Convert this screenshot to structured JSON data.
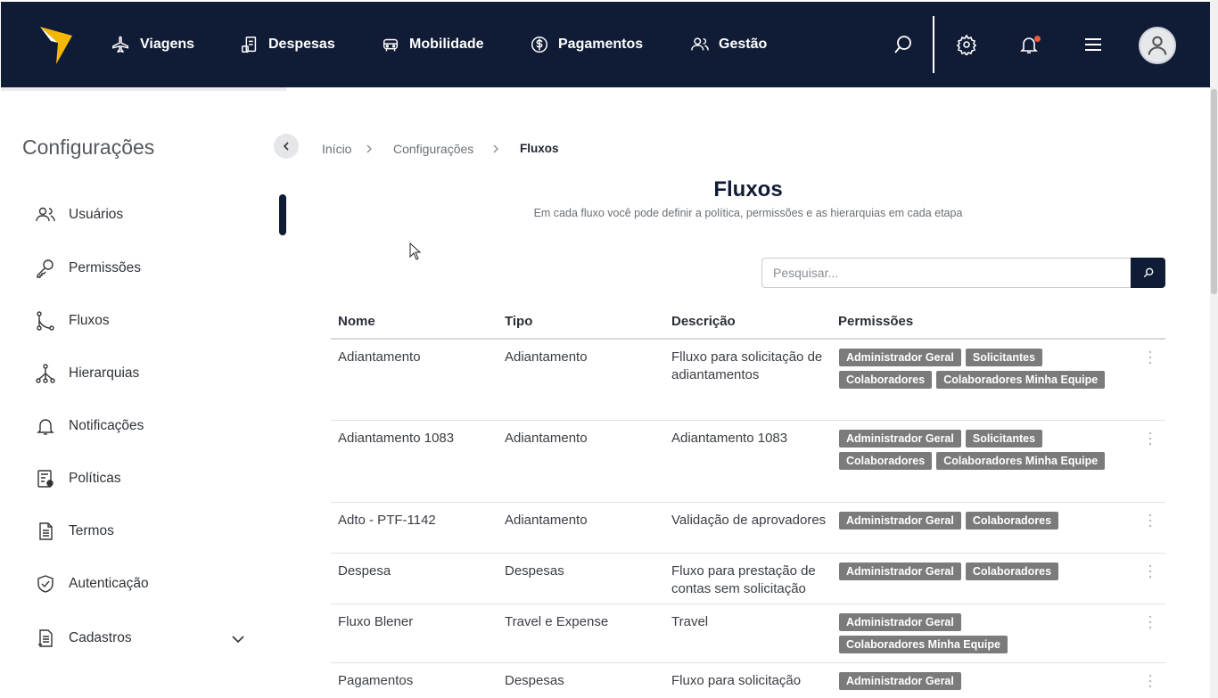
{
  "nav": {
    "items": [
      {
        "label": "Viagens",
        "icon": "airplane-icon"
      },
      {
        "label": "Despesas",
        "icon": "receipt-icon"
      },
      {
        "label": "Mobilidade",
        "icon": "car-icon"
      },
      {
        "label": "Pagamentos",
        "icon": "dollar-circle-icon"
      },
      {
        "label": "Gestão",
        "icon": "users-icon"
      }
    ]
  },
  "sidebar": {
    "title": "Configurações",
    "items": [
      {
        "label": "Usuários",
        "icon": "users-icon"
      },
      {
        "label": "Permissões",
        "icon": "key-icon"
      },
      {
        "label": "Fluxos",
        "icon": "flow-icon"
      },
      {
        "label": "Hierarquias",
        "icon": "hierarchy-icon"
      },
      {
        "label": "Notificações",
        "icon": "bell-icon"
      },
      {
        "label": "Políticas",
        "icon": "policy-icon"
      },
      {
        "label": "Termos",
        "icon": "document-icon"
      },
      {
        "label": "Autenticação",
        "icon": "shield-icon"
      },
      {
        "label": "Cadastros",
        "icon": "file-list-icon"
      }
    ]
  },
  "breadcrumb": {
    "items": [
      "Início",
      "Configurações",
      "Fluxos"
    ]
  },
  "page": {
    "title": "Fluxos",
    "subtitle": "Em cada fluxo você pode definir a política, permissões e as hierarquias em cada etapa"
  },
  "search": {
    "placeholder": "Pesquisar..."
  },
  "table": {
    "headers": [
      "Nome",
      "Tipo",
      "Descrição",
      "Permissões"
    ],
    "rows": [
      {
        "name": "Adiantamento",
        "type": "Adiantamento",
        "desc": "Flluxo para solicitação de adiantamentos",
        "perms": [
          "Administrador Geral",
          "Solicitantes",
          "Colaboradores",
          "Colaboradores Minha Equipe"
        ]
      },
      {
        "name": "Adiantamento 1083",
        "type": "Adiantamento",
        "desc": "Adiantamento 1083",
        "perms": [
          "Administrador Geral",
          "Solicitantes",
          "Colaboradores",
          "Colaboradores Minha Equipe"
        ]
      },
      {
        "name": "Adto - PTF-1142",
        "type": "Adiantamento",
        "desc": "Validação de aprovadores",
        "perms": [
          "Administrador Geral",
          "Colaboradores"
        ]
      },
      {
        "name": "Despesa",
        "type": "Despesas",
        "desc": "Fluxo para prestação de contas sem solicitação",
        "perms": [
          "Administrador Geral",
          "Colaboradores"
        ]
      },
      {
        "name": "Fluxo Blener",
        "type": "Travel e Expense",
        "desc": "Travel",
        "perms": [
          "Administrador Geral",
          "Colaboradores Minha Equipe"
        ]
      },
      {
        "name": "Pagamentos",
        "type": "Despesas",
        "desc": "Fluxo para solicitação",
        "perms": [
          "Administrador Geral"
        ]
      }
    ]
  },
  "colors": {
    "navy": "#101b35",
    "tag_gray": "#7b7b7b",
    "logo_yellow": "#f5b800",
    "notification": "#f05a3a"
  }
}
